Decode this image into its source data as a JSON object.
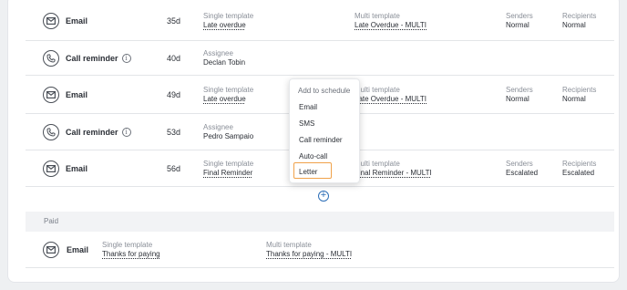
{
  "schedule": [
    {
      "type": "Email",
      "icon": "envelope-icon",
      "days": "35d",
      "single_label": "Single template",
      "single_value": "Late overdue",
      "multi_label": "Multi template",
      "multi_value": "Late Overdue - MULTI",
      "senders_label": "Senders",
      "senders_value": "Normal",
      "recipients_label": "Recipients",
      "recipients_value": "Normal"
    },
    {
      "type": "Call reminder",
      "icon": "phone-icon",
      "days": "40d",
      "assignee_label": "Assignee",
      "assignee_value": "Declan Tobin"
    },
    {
      "type": "Email",
      "icon": "envelope-icon",
      "days": "49d",
      "single_label": "Single template",
      "single_value": "Late overdue",
      "multi_label": "Multi template",
      "multi_value": "Late Overdue - MULTI",
      "senders_label": "Senders",
      "senders_value": "Normal",
      "recipients_label": "Recipients",
      "recipients_value": "Normal"
    },
    {
      "type": "Call reminder",
      "icon": "phone-icon",
      "days": "53d",
      "assignee_label": "Assignee",
      "assignee_value": "Pedro Sampaio"
    },
    {
      "type": "Email",
      "icon": "envelope-icon",
      "days": "56d",
      "single_label": "Single template",
      "single_value": "Final Reminder",
      "multi_label": "Multi template",
      "multi_value": "Final Reminder - MULTI",
      "senders_label": "Senders",
      "senders_value": "Escalated",
      "recipients_label": "Recipients",
      "recipients_value": "Escalated"
    }
  ],
  "dropdown": {
    "title": "Add to schedule",
    "items": [
      "Email",
      "SMS",
      "Call reminder",
      "Auto-call",
      "Letter"
    ],
    "highlighted": "Letter"
  },
  "add_icon": "plus-circle-icon",
  "paid": {
    "section_label": "Paid",
    "type": "Email",
    "single_label": "Single template",
    "single_value": "Thanks for paying",
    "multi_label": "Multi template",
    "multi_value": "Thanks for paying - MULTI"
  },
  "colors": {
    "accent": "#2d6fb8",
    "highlight": "#f0a24a"
  }
}
